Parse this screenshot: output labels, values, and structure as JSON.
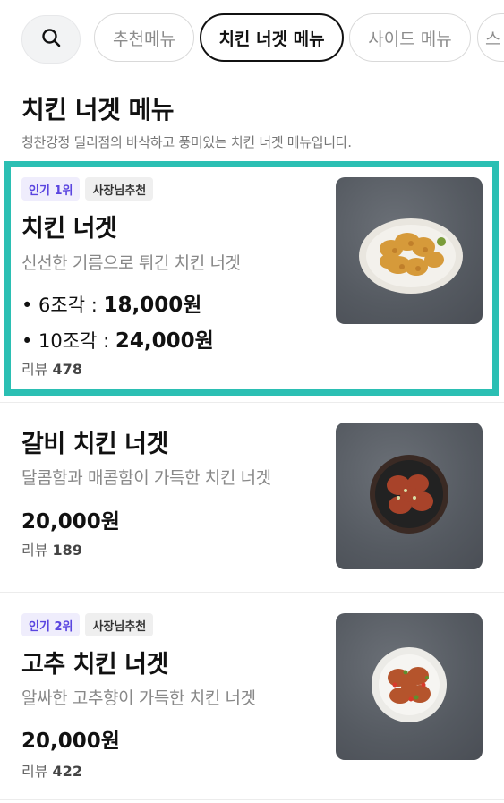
{
  "tabs": [
    {
      "label": "추천메뉴",
      "active": false
    },
    {
      "label": "치킨 너겟 메뉴",
      "active": true
    },
    {
      "label": "사이드 메뉴",
      "active": false
    },
    {
      "label": "스",
      "active": false
    }
  ],
  "section": {
    "title": "치킨 너겟 메뉴",
    "description": "칭찬강정 딜리점의 바삭하고 풍미있는 치킨 너겟 메뉴입니다."
  },
  "items": [
    {
      "badges": [
        "인기 1위",
        "사장님추천"
      ],
      "name": "치킨 너겟",
      "description": "신선한 기름으로 튀긴 치킨 너겟",
      "options": [
        {
          "label": "• 6조각 : ",
          "price": "18,000원"
        },
        {
          "label": "• 10조각 : ",
          "price": "24,000원"
        }
      ],
      "review_label": "리뷰",
      "review_count": "478",
      "highlighted": true
    },
    {
      "name": "갈비 치킨 너겟",
      "description": "달콤함과 매콤함이 가득한 치킨 너겟",
      "price": "20,000원",
      "review_label": "리뷰",
      "review_count": "189"
    },
    {
      "badges": [
        "인기 2위",
        "사장님추천"
      ],
      "name": "고추 치킨 너겟",
      "description": "알싸한 고추향이 가득한 치킨 너겟",
      "price": "20,000원",
      "review_label": "리뷰",
      "review_count": "422"
    }
  ],
  "colors": {
    "highlight": "#2bbfb3",
    "rank_badge_text": "#5a45e0"
  }
}
